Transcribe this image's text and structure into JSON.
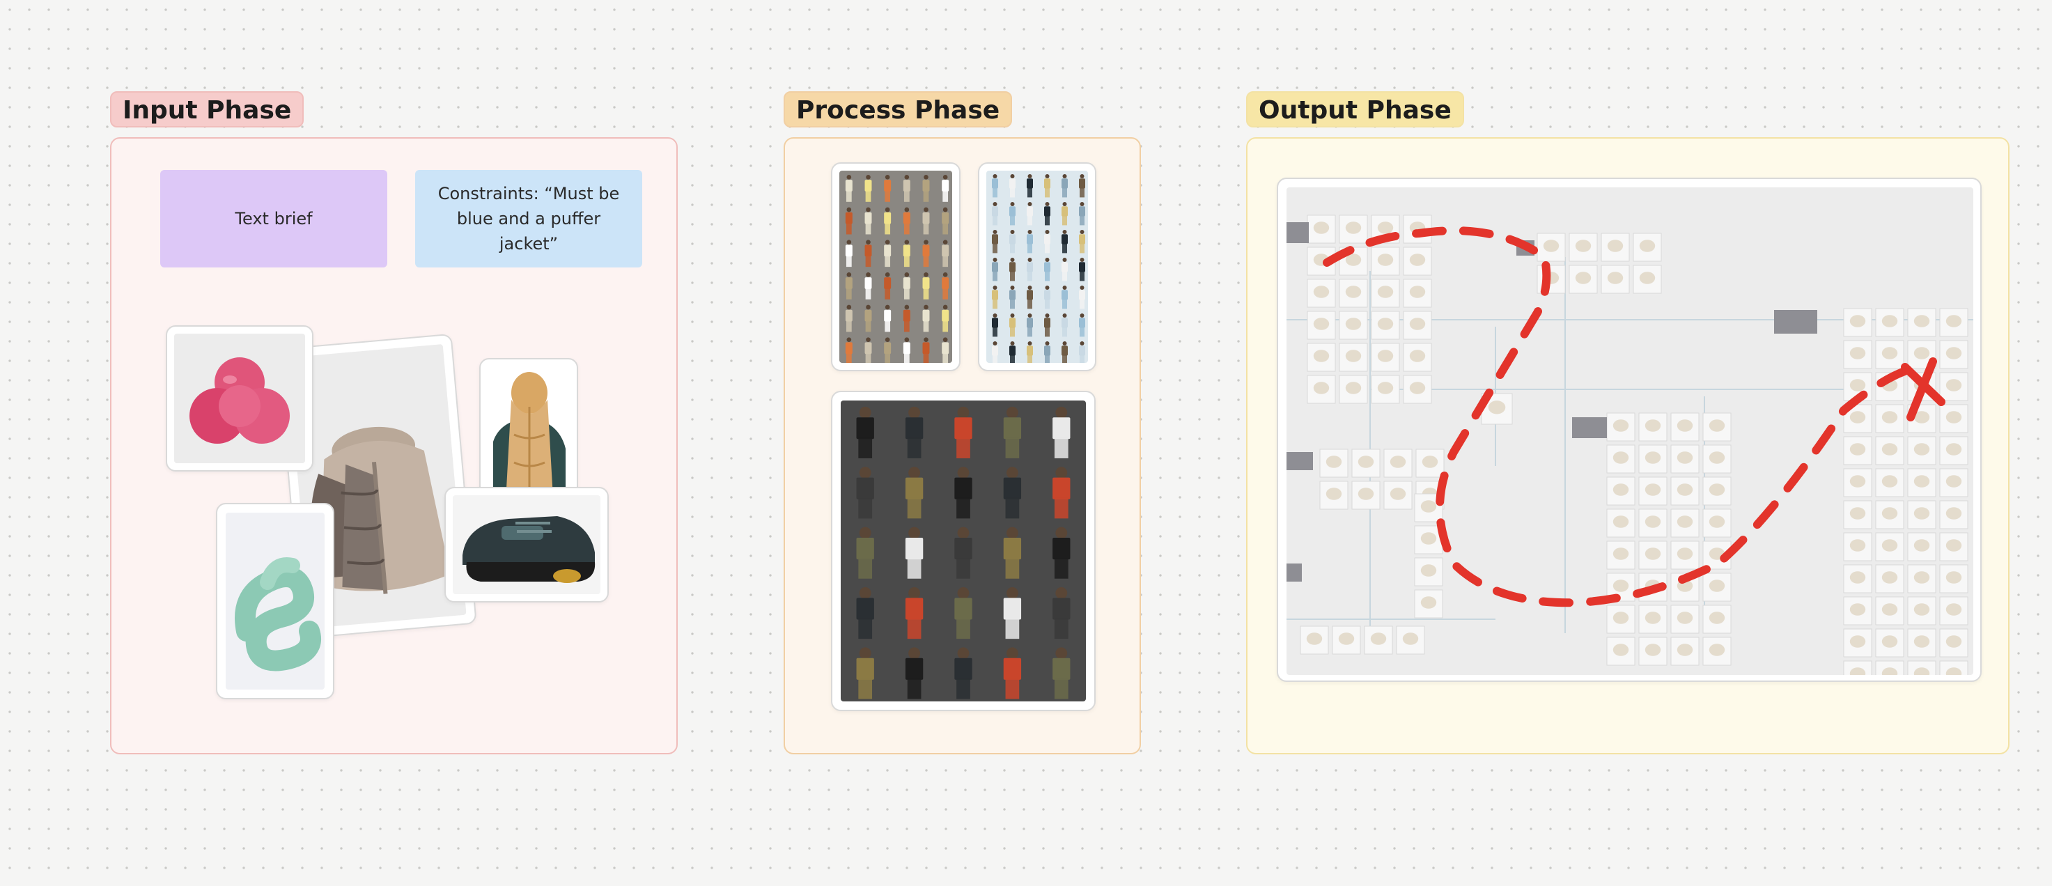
{
  "phases": {
    "input": {
      "label": "Input Phase",
      "label_color": "#f6cccb",
      "box_bg": "#fdf3f2",
      "box_border": "#f0bdbb"
    },
    "process": {
      "label": "Process Phase",
      "label_color": "#f6d8a7",
      "box_bg": "#fdf5ec",
      "box_border": "#f1cfa3"
    },
    "output": {
      "label": "Output Phase",
      "label_color": "#f7e6a6",
      "box_bg": "#fefaea",
      "box_border": "#f3e2a4"
    }
  },
  "input": {
    "text_brief": "Text brief",
    "constraints": "Constraints: “Must be blue and a puffer jacket”",
    "moodboard_images": [
      "pink-blob-render",
      "puffer-jacket-photo",
      "puffer-scarf-photo",
      "chunky-sneaker-photo",
      "mint-knot-render"
    ]
  },
  "process": {
    "grids": [
      "lineup-grid-warm",
      "lineup-grid-cool",
      "lineup-grid-dark"
    ]
  },
  "output": {
    "canvas": "node-graph-screenshot",
    "annotation_color": "#e3342b"
  }
}
